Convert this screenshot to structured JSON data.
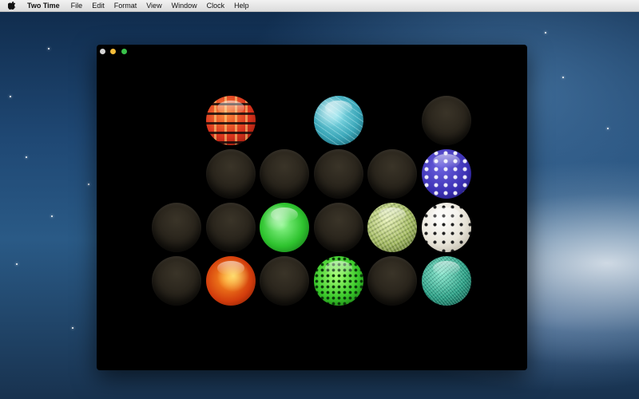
{
  "menubar": {
    "apple_icon": "apple-icon",
    "app_name": "Two Time",
    "items": [
      "File",
      "Edit",
      "Format",
      "View",
      "Window",
      "Clock",
      "Help"
    ]
  },
  "window": {
    "controls": [
      "close",
      "minimize",
      "zoom"
    ],
    "grid": {
      "rows": 4,
      "cols": 6,
      "cells": [
        [
          "none",
          "red-stripe",
          "none",
          "cyan-water",
          "none",
          "empty"
        ],
        [
          "none",
          "empty",
          "empty",
          "empty",
          "empty",
          "purple-pattern"
        ],
        [
          "empty",
          "empty",
          "green-glass",
          "empty",
          "green-fur",
          "white-dots"
        ],
        [
          "empty",
          "orange-fire",
          "empty",
          "green-dots",
          "empty",
          "teal-fiber"
        ]
      ]
    }
  }
}
